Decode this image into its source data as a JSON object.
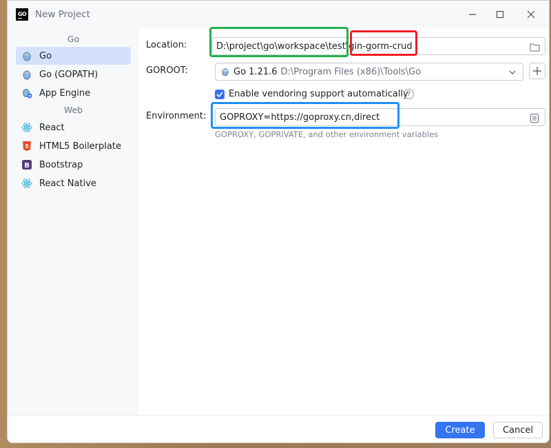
{
  "window": {
    "title": "New Project",
    "logo_text": "GO"
  },
  "sidebar": {
    "groups": [
      {
        "label": "Go",
        "items": [
          {
            "label": "Go",
            "icon": "gopher-icon",
            "selected": true
          },
          {
            "label": "Go (GOPATH)",
            "icon": "gopher-icon"
          },
          {
            "label": "App Engine",
            "icon": "app-engine-icon"
          }
        ]
      },
      {
        "label": "Web",
        "items": [
          {
            "label": "React",
            "icon": "react-icon"
          },
          {
            "label": "HTML5 Boilerplate",
            "icon": "html5-icon"
          },
          {
            "label": "Bootstrap",
            "icon": "bootstrap-icon"
          },
          {
            "label": "React Native",
            "icon": "react-icon"
          }
        ]
      }
    ]
  },
  "form": {
    "location": {
      "label": "Location:",
      "path_prefix": "D:\\project\\go\\workspace\\test\\",
      "project_name": "gin-gorm-crud"
    },
    "goroot": {
      "label": "GOROOT:",
      "version": "Go 1.21.6",
      "path": "D:\\Program Files (x86)\\Tools\\Go"
    },
    "vendoring": {
      "label": "Enable vendoring support automatically",
      "checked": true,
      "help": "?"
    },
    "environment": {
      "label": "Environment:",
      "value": "GOPROXY=https://goproxy.cn,direct",
      "hint": "GOPROXY, GOPRIVATE, and other environment variables"
    }
  },
  "footer": {
    "create_label": "Create",
    "cancel_label": "Cancel"
  },
  "colors": {
    "accent": "#3574f0",
    "selection": "#d5e1fb",
    "highlight_green": "#22b14c",
    "highlight_red": "#ed1c24",
    "highlight_blue": "#1e90ff"
  }
}
